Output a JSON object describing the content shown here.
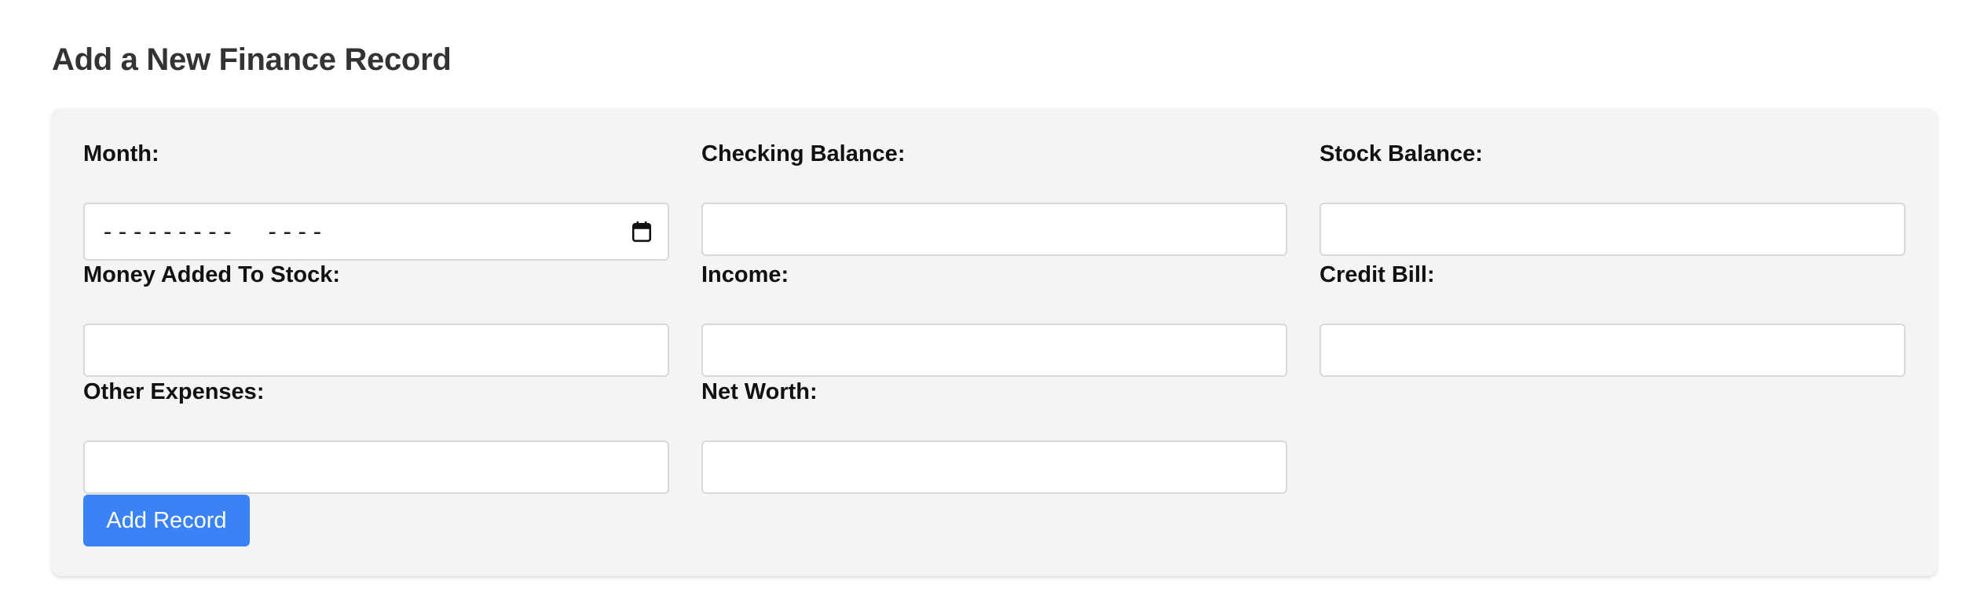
{
  "page": {
    "title": "Add a New Finance Record"
  },
  "form": {
    "fields": [
      {
        "label": "Month:",
        "value": "",
        "placeholder": "---------  ----",
        "type": "month"
      },
      {
        "label": "Checking Balance:",
        "value": "",
        "placeholder": ""
      },
      {
        "label": "Stock Balance:",
        "value": "",
        "placeholder": ""
      },
      {
        "label": "Money Added To Stock:",
        "value": "",
        "placeholder": ""
      },
      {
        "label": "Income:",
        "value": "",
        "placeholder": ""
      },
      {
        "label": "Credit Bill:",
        "value": "",
        "placeholder": ""
      },
      {
        "label": "Other Expenses:",
        "value": "",
        "placeholder": ""
      },
      {
        "label": "Net Worth:",
        "value": "",
        "placeholder": ""
      }
    ],
    "submit_label": "Add Record",
    "month_icon": "calendar-icon"
  },
  "colors": {
    "primary": "#3b82f6",
    "card_background": "#f4f4f4",
    "title": "#333333"
  }
}
